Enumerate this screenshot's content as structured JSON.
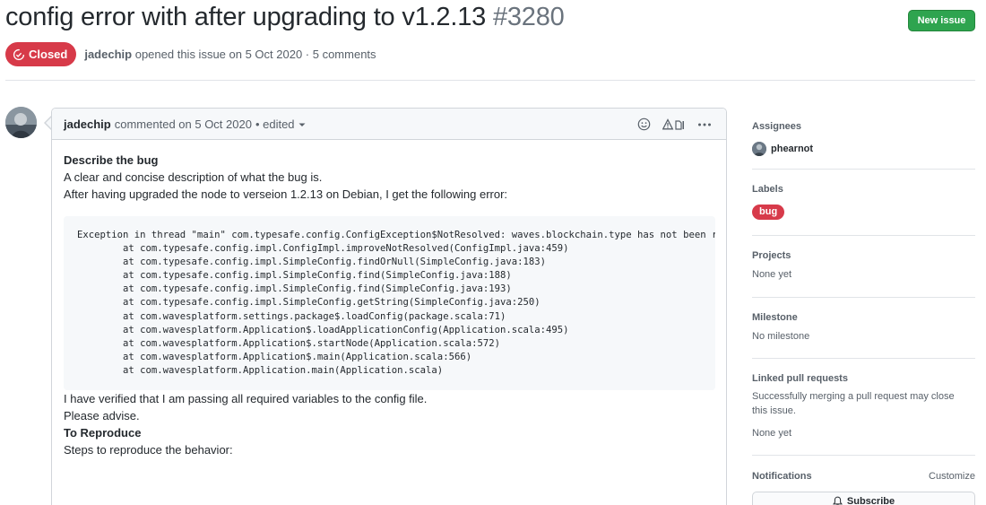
{
  "issue": {
    "title": "config error with after upgrading to v1.2.13",
    "number": "#3280",
    "state": "Closed",
    "author": "jadechip",
    "opened_text": "opened this issue on 5 Oct 2020 · 5 comments",
    "new_issue_label": "New issue"
  },
  "comment": {
    "author": "jadechip",
    "meta": "commented on 5 Oct 2020",
    "edited": "• edited",
    "body": {
      "heading1": "Describe the bug",
      "line1": "A clear and concise description of what the bug is.",
      "line2": "After having upgraded the node to verseion 1.2.13 on Debian, I get the following error:",
      "code": "Exception in thread \"main\" com.typesafe.config.ConfigException$NotResolved: waves.blockchain.type has not been r\n        at com.typesafe.config.impl.ConfigImpl.improveNotResolved(ConfigImpl.java:459)\n        at com.typesafe.config.impl.SimpleConfig.findOrNull(SimpleConfig.java:183)\n        at com.typesafe.config.impl.SimpleConfig.find(SimpleConfig.java:188)\n        at com.typesafe.config.impl.SimpleConfig.find(SimpleConfig.java:193)\n        at com.typesafe.config.impl.SimpleConfig.getString(SimpleConfig.java:250)\n        at com.wavesplatform.settings.package$.loadConfig(package.scala:71)\n        at com.wavesplatform.Application$.loadApplicationConfig(Application.scala:495)\n        at com.wavesplatform.Application$.startNode(Application.scala:572)\n        at com.wavesplatform.Application$.main(Application.scala:566)\n        at com.wavesplatform.Application.main(Application.scala)",
      "para1": "I have verified that I am passing all required variables to the config file.",
      "para2": "Please advise.",
      "heading2": "To Reproduce",
      "line3": "Steps to reproduce the behavior:"
    }
  },
  "sidebar": {
    "assignees": {
      "heading": "Assignees",
      "user": "phearnot"
    },
    "labels": {
      "heading": "Labels",
      "label": "bug",
      "label_color": "#d73a4a"
    },
    "projects": {
      "heading": "Projects",
      "value": "None yet"
    },
    "milestone": {
      "heading": "Milestone",
      "value": "No milestone"
    },
    "linked_prs": {
      "heading": "Linked pull requests",
      "description": "Successfully merging a pull request may close this issue.",
      "value": "None yet"
    },
    "notifications": {
      "heading": "Notifications",
      "customize": "Customize",
      "subscribe": "Subscribe"
    }
  },
  "colors": {
    "closed": "#d73a49",
    "new_issue": "#2ea44f"
  }
}
